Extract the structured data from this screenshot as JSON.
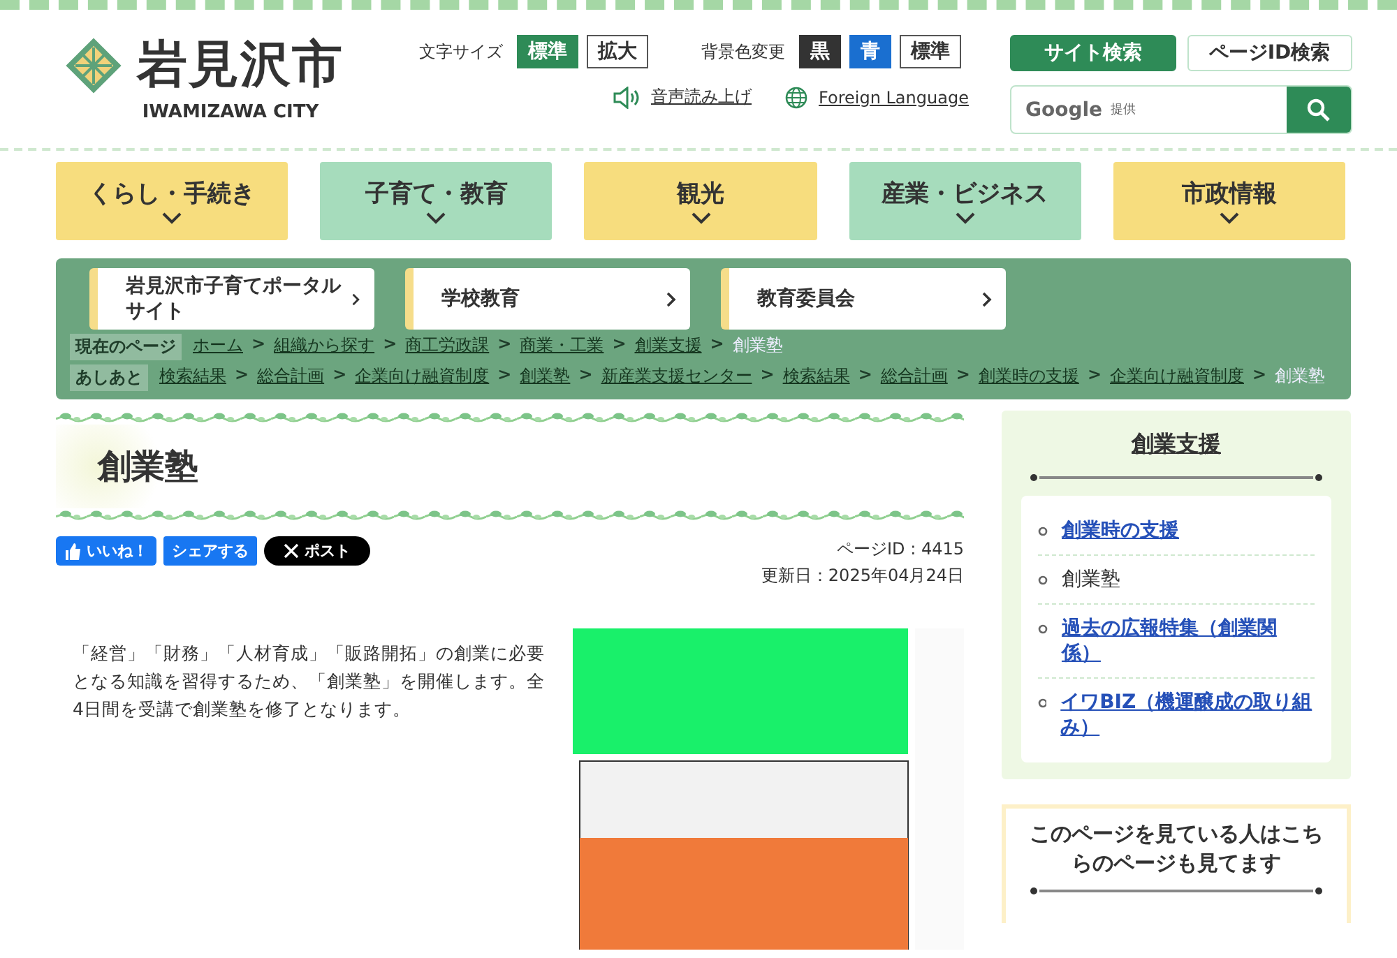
{
  "header": {
    "logo_name": "岩見沢市",
    "logo_sub": "IWAMIZAWA CITY",
    "font_size": {
      "label": "文字サイズ",
      "options": [
        {
          "label": "標準",
          "selected": true
        },
        {
          "label": "拡大",
          "selected": false
        }
      ]
    },
    "bg_color": {
      "label": "背景色変更",
      "options": [
        {
          "label": "黒",
          "kind": "black"
        },
        {
          "label": "青",
          "kind": "blue"
        },
        {
          "label": "標準",
          "kind": "standard"
        }
      ]
    },
    "links": [
      {
        "label": "音声読み上げ",
        "kind": "speaker"
      },
      {
        "label": "Foreign Language",
        "kind": "globe"
      }
    ],
    "search_tabs": [
      {
        "label": "サイト検索",
        "selected": true
      },
      {
        "label": "ページID検索",
        "selected": false
      }
    ],
    "search": {
      "brand": "Google",
      "placeholder": "提供"
    }
  },
  "nav": [
    {
      "label": "くらし・手続き",
      "color": "#f7dd7e"
    },
    {
      "label": "子育て・教育",
      "color": "#a6dcbc"
    },
    {
      "label": "観光",
      "color": "#f7dd7e"
    },
    {
      "label": "産業・ビジネス",
      "color": "#a6dcbc"
    },
    {
      "label": "市政情報",
      "color": "#f7dd7e"
    }
  ],
  "popup_cards": [
    {
      "label": "岩見沢市子育てポータルサイト"
    },
    {
      "label": "学校教育"
    },
    {
      "label": "教育委員会"
    }
  ],
  "breadcrumbs": [
    {
      "label": "現在のページ",
      "separator": ">",
      "items": [
        {
          "label": "ホーム",
          "link": true
        },
        {
          "label": "組織から探す",
          "link": true
        },
        {
          "label": "商工労政課",
          "link": true
        },
        {
          "label": "商業・工業",
          "link": true
        },
        {
          "label": "創業支援",
          "link": true
        },
        {
          "label": "創業塾",
          "link": false
        }
      ]
    },
    {
      "label": "あしあと",
      "separator": ">",
      "items": [
        {
          "label": "検索結果",
          "link": true
        },
        {
          "label": "総合計画",
          "link": true
        },
        {
          "label": "企業向け融資制度",
          "link": true
        },
        {
          "label": "創業塾",
          "link": true
        },
        {
          "label": "新産業支援センター",
          "link": true
        },
        {
          "label": "検索結果",
          "link": true
        },
        {
          "label": "総合計画",
          "link": true
        },
        {
          "label": "創業時の支援",
          "link": true
        },
        {
          "label": "企業向け融資制度",
          "link": true
        },
        {
          "label": "創業塾",
          "link": false
        }
      ]
    }
  ],
  "main": {
    "title": "創業塾",
    "social": [
      {
        "label": "いいね！",
        "kind": "like"
      },
      {
        "label": "シェアする",
        "kind": "share"
      },
      {
        "label": "ポスト",
        "kind": "x"
      }
    ],
    "page_id": "ページID : 4415",
    "updated": "更新日：2025年04月24日",
    "body": "「経営」「財務」「人材育成」「販路開拓」の創業に必要となる知識を習得するため、「創業塾」を開催します。全4日間を受講で創業塾を修了となります。"
  },
  "sidebar": {
    "heading": "創業支援",
    "items": [
      {
        "label": "創業時の支援",
        "selected": false
      },
      {
        "label": "創業塾",
        "selected": true
      },
      {
        "label": "過去の広報特集（創業関係）",
        "selected": false
      },
      {
        "label": "イワBIZ（機運醸成の取り組み）",
        "selected": false
      }
    ],
    "related_heading": "このページを見ている人はこちらのページも見てます"
  }
}
